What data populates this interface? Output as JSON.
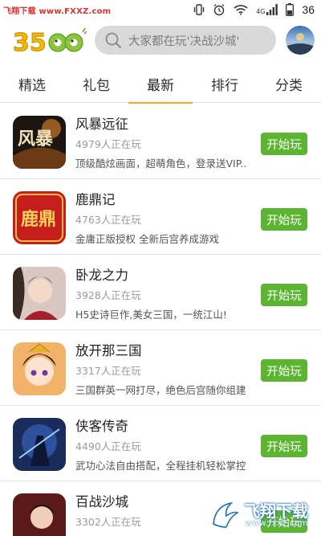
{
  "status_bar": {
    "watermark": "飞翔下载 www.FXXZ.com",
    "network": "4G",
    "battery_level": "36",
    "icons": [
      "vibrate-icon",
      "alarm-icon",
      "wifi-icon",
      "signal-icon",
      "battery-icon"
    ]
  },
  "header": {
    "logo_text": "3500",
    "search_placeholder": "大家都在玩'决战沙城'"
  },
  "tabs": [
    {
      "label": "精选",
      "active": false
    },
    {
      "label": "礼包",
      "active": false
    },
    {
      "label": "最新",
      "active": true
    },
    {
      "label": "排行",
      "active": false
    },
    {
      "label": "分类",
      "active": false
    }
  ],
  "games": [
    {
      "name": "风暴远征",
      "players": "4979人正在玩",
      "desc": "顶级酷炫画面，超萌角色，登录送VIP..",
      "button": "开始玩",
      "thumb_text": "风暴"
    },
    {
      "name": "鹿鼎记",
      "players": "4763人正在玩",
      "desc": "金庸正版授权 全新后宫养成游戏",
      "button": "开始玩",
      "thumb_text": "鹿鼎"
    },
    {
      "name": "卧龙之力",
      "players": "3928人正在玩",
      "desc": "H5史诗巨作,美女三国，一统江山!",
      "button": "开始玩",
      "thumb_text": ""
    },
    {
      "name": "放开那三国",
      "players": "3317人正在玩",
      "desc": "三国群英一网打尽，绝色后宫随你组建",
      "button": "开始玩",
      "thumb_text": ""
    },
    {
      "name": "侠客传奇",
      "players": "4490人正在玩",
      "desc": "武功心法自由搭配，全程挂机轻松掌控",
      "button": "开始玩",
      "thumb_text": ""
    },
    {
      "name": "百战沙城",
      "players": "3302人正在玩",
      "desc": "",
      "button": "开始玩",
      "thumb_text": ""
    }
  ],
  "watermark": {
    "main": "飞翔下载",
    "sub": "www.fxxz.com"
  },
  "colors": {
    "accent_tab": "#f5a623",
    "play_button": "#5cb531",
    "search_bg": "#d9d9d9"
  }
}
